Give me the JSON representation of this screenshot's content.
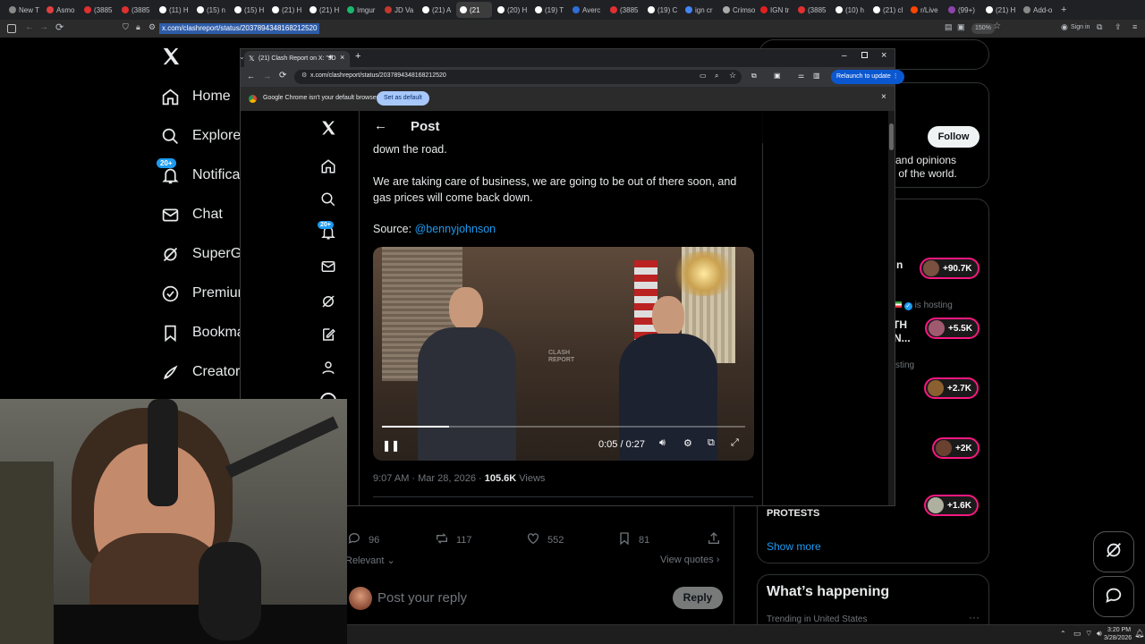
{
  "outer_browser": {
    "tabs": [
      {
        "label": "New T",
        "color": "#888888"
      },
      {
        "label": "Asmo",
        "color": "#e04040"
      },
      {
        "label": "(3885",
        "color": "#e03030"
      },
      {
        "label": "(3885",
        "color": "#e03030"
      },
      {
        "label": "(11) H",
        "color": "#ffffff"
      },
      {
        "label": "(15) n",
        "color": "#ffffff"
      },
      {
        "label": "(15) H",
        "color": "#ffffff"
      },
      {
        "label": "(21) H",
        "color": "#ffffff"
      },
      {
        "label": "(21) H",
        "color": "#ffffff"
      },
      {
        "label": "Imgur",
        "color": "#1bb76e"
      },
      {
        "label": "JD Va",
        "color": "#c0392b"
      },
      {
        "label": "(21) A",
        "color": "#ffffff"
      },
      {
        "label": "(21",
        "color": "#ffffff"
      },
      {
        "label": "(20) H",
        "color": "#ffffff"
      },
      {
        "label": "(19) T",
        "color": "#ffffff"
      },
      {
        "label": "Averc",
        "color": "#2f6fd6"
      },
      {
        "label": "(3885",
        "color": "#e03030"
      },
      {
        "label": "(19) C",
        "color": "#ffffff"
      },
      {
        "label": "ign cr",
        "color": "#4285f4"
      },
      {
        "label": "Crimso",
        "color": "#aaaaaa"
      },
      {
        "label": "IGN tr",
        "color": "#e02020"
      },
      {
        "label": "(3885",
        "color": "#e03030"
      },
      {
        "label": "(10) h",
        "color": "#ffffff"
      },
      {
        "label": "(21) cl",
        "color": "#ffffff"
      },
      {
        "label": "r/Live",
        "color": "#ff4500"
      },
      {
        "label": "(99+)",
        "color": "#8e44ad"
      },
      {
        "label": "(21) H",
        "color": "#ffffff"
      },
      {
        "label": "Add-o",
        "color": "#888888"
      }
    ],
    "url": "x.com/clashreport/status/2037894348168212520",
    "zoom": "150%",
    "sign_in": "Sign in"
  },
  "x_sidebar": {
    "items": [
      {
        "label": "Home",
        "icon": "home-icon"
      },
      {
        "label": "Explore",
        "icon": "search-icon"
      },
      {
        "label": "Notifica",
        "icon": "bell-icon"
      },
      {
        "label": "Chat",
        "icon": "mail-icon"
      },
      {
        "label": "SuperG",
        "icon": "grok-icon"
      },
      {
        "label": "Premium",
        "icon": "premium-icon"
      },
      {
        "label": "Bookma",
        "icon": "bookmark-icon"
      },
      {
        "label": "Creator",
        "icon": "rocket-icon"
      }
    ],
    "notif_badge": "20+"
  },
  "inner_browser": {
    "tab_title": "(21) Clash Report on X: \"JD",
    "url": "x.com/clashreport/status/2037894348168212520",
    "relaunch_label": "Relaunch to update",
    "default_notice": "Google Chrome isn't your default browser",
    "set_default": "Set as default"
  },
  "post": {
    "header": "Post",
    "text_partial": "down the road.",
    "text_main": "We are taking care of business, we are going to be out of there soon, and gas prices will come back down.",
    "source_label": "Source:",
    "source_handle": "@bennyjohnson",
    "video_time": "0:05 / 0:27",
    "video_watermark": "CLASH REPORT",
    "video_progress": 0.185,
    "timestamp": "9:07 AM · Mar 28, 2026 ·",
    "views_count": "105.6K",
    "views_label": "Views",
    "notif_badge": "20+"
  },
  "bg_post": {
    "replies": "96",
    "reposts": "117",
    "likes": "552",
    "bookmarks": "81",
    "relevant": "Relevant",
    "view_quotes": "View quotes",
    "reply_placeholder": "Post your reply",
    "reply_button": "Reply"
  },
  "right_col": {
    "follow": "Follow",
    "promo_line1": "ts, and opinions",
    "promo_line2": "s of the world.",
    "frag_n": "n",
    "is_hosting": "is hosting",
    "frag_th": "TH",
    "frag_n2": "N...",
    "frag_sting": "sting",
    "protests": "PROTESTS",
    "show_more": "Show more",
    "whats_happening": "What’s happening",
    "trending": "Trending in United States",
    "space_counts": [
      "+90.7K",
      "+5.5K",
      "+2.7K",
      "+2K",
      "+1.6K"
    ]
  },
  "taskbar": {
    "time": "3:20 PM",
    "date": "3/28/2026"
  }
}
